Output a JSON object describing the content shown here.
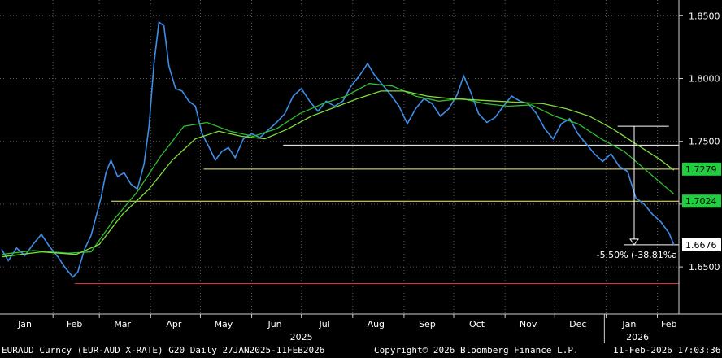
{
  "chart_data": {
    "type": "line",
    "series": [
      {
        "name": "",
        "color": "#3d8ee8",
        "values": [
          [
            "2025-01-01",
            1.664
          ],
          [
            "2025-01-05",
            1.655
          ],
          [
            "2025-01-10",
            1.665
          ],
          [
            "2025-01-15",
            1.659
          ],
          [
            "2025-01-20",
            1.668
          ],
          [
            "2025-01-25",
            1.676
          ],
          [
            "2025-01-30",
            1.666
          ],
          [
            "2025-02-04",
            1.658
          ],
          [
            "2025-02-08",
            1.65
          ],
          [
            "2025-02-13",
            1.642
          ],
          [
            "2025-02-16",
            1.646
          ],
          [
            "2025-02-20",
            1.664
          ],
          [
            "2025-02-24",
            1.675
          ],
          [
            "2025-02-27",
            1.69
          ],
          [
            "2025-03-02",
            1.705
          ],
          [
            "2025-03-05",
            1.725
          ],
          [
            "2025-03-08",
            1.735
          ],
          [
            "2025-03-12",
            1.722
          ],
          [
            "2025-03-16",
            1.725
          ],
          [
            "2025-03-20",
            1.716
          ],
          [
            "2025-03-24",
            1.712
          ],
          [
            "2025-03-28",
            1.732
          ],
          [
            "2025-03-31",
            1.762
          ],
          [
            "2025-04-03",
            1.812
          ],
          [
            "2025-04-06",
            1.845
          ],
          [
            "2025-04-09",
            1.842
          ],
          [
            "2025-04-12",
            1.81
          ],
          [
            "2025-04-16",
            1.792
          ],
          [
            "2025-04-20",
            1.79
          ],
          [
            "2025-04-24",
            1.782
          ],
          [
            "2025-04-28",
            1.778
          ],
          [
            "2025-05-02",
            1.756
          ],
          [
            "2025-05-06",
            1.746
          ],
          [
            "2025-05-10",
            1.735
          ],
          [
            "2025-05-14",
            1.742
          ],
          [
            "2025-05-18",
            1.745
          ],
          [
            "2025-05-22",
            1.737
          ],
          [
            "2025-05-27",
            1.752
          ],
          [
            "2025-06-01",
            1.756
          ],
          [
            "2025-06-06",
            1.753
          ],
          [
            "2025-06-11",
            1.759
          ],
          [
            "2025-06-16",
            1.765
          ],
          [
            "2025-06-21",
            1.772
          ],
          [
            "2025-06-26",
            1.786
          ],
          [
            "2025-07-01",
            1.792
          ],
          [
            "2025-07-06",
            1.782
          ],
          [
            "2025-07-11",
            1.774
          ],
          [
            "2025-07-16",
            1.782
          ],
          [
            "2025-07-21",
            1.778
          ],
          [
            "2025-07-26",
            1.782
          ],
          [
            "2025-07-31",
            1.794
          ],
          [
            "2025-08-05",
            1.802
          ],
          [
            "2025-08-10",
            1.812
          ],
          [
            "2025-08-14",
            1.803
          ],
          [
            "2025-08-19",
            1.795
          ],
          [
            "2025-08-24",
            1.787
          ],
          [
            "2025-08-29",
            1.778
          ],
          [
            "2025-09-03",
            1.764
          ],
          [
            "2025-09-08",
            1.776
          ],
          [
            "2025-09-13",
            1.784
          ],
          [
            "2025-09-18",
            1.78
          ],
          [
            "2025-09-23",
            1.77
          ],
          [
            "2025-09-28",
            1.776
          ],
          [
            "2025-10-03",
            1.787
          ],
          [
            "2025-10-07",
            1.802
          ],
          [
            "2025-10-11",
            1.79
          ],
          [
            "2025-10-16",
            1.772
          ],
          [
            "2025-10-21",
            1.765
          ],
          [
            "2025-10-26",
            1.769
          ],
          [
            "2025-10-31",
            1.778
          ],
          [
            "2025-11-05",
            1.786
          ],
          [
            "2025-11-10",
            1.782
          ],
          [
            "2025-11-15",
            1.78
          ],
          [
            "2025-11-20",
            1.772
          ],
          [
            "2025-11-25",
            1.76
          ],
          [
            "2025-11-30",
            1.752
          ],
          [
            "2025-12-05",
            1.764
          ],
          [
            "2025-12-10",
            1.768
          ],
          [
            "2025-12-15",
            1.756
          ],
          [
            "2025-12-20",
            1.748
          ],
          [
            "2025-12-25",
            1.74
          ],
          [
            "2025-12-30",
            1.734
          ],
          [
            "2026-01-04",
            1.74
          ],
          [
            "2026-01-09",
            1.73
          ],
          [
            "2026-01-14",
            1.726
          ],
          [
            "2026-01-19",
            1.705
          ],
          [
            "2026-01-24",
            1.7
          ],
          [
            "2026-01-29",
            1.692
          ],
          [
            "2026-02-03",
            1.686
          ],
          [
            "2026-02-08",
            1.677
          ],
          [
            "2026-02-11",
            1.6676
          ]
        ]
      },
      {
        "name": "",
        "color": "#2fbf2f",
        "values": [
          [
            "2025-01-01",
            1.66
          ],
          [
            "2025-01-20",
            1.663
          ],
          [
            "2025-02-10",
            1.661
          ],
          [
            "2025-02-24",
            1.662
          ],
          [
            "2025-03-10",
            1.688
          ],
          [
            "2025-03-24",
            1.71
          ],
          [
            "2025-04-07",
            1.738
          ],
          [
            "2025-04-21",
            1.762
          ],
          [
            "2025-05-05",
            1.765
          ],
          [
            "2025-05-19",
            1.758
          ],
          [
            "2025-06-02",
            1.754
          ],
          [
            "2025-06-16",
            1.76
          ],
          [
            "2025-06-30",
            1.772
          ],
          [
            "2025-07-14",
            1.78
          ],
          [
            "2025-07-28",
            1.786
          ],
          [
            "2025-08-11",
            1.796
          ],
          [
            "2025-08-25",
            1.794
          ],
          [
            "2025-09-08",
            1.786
          ],
          [
            "2025-09-22",
            1.782
          ],
          [
            "2025-10-06",
            1.784
          ],
          [
            "2025-10-20",
            1.78
          ],
          [
            "2025-11-03",
            1.778
          ],
          [
            "2025-11-17",
            1.779
          ],
          [
            "2025-12-01",
            1.77
          ],
          [
            "2025-12-15",
            1.764
          ],
          [
            "2025-12-29",
            1.752
          ],
          [
            "2026-01-12",
            1.742
          ],
          [
            "2026-01-26",
            1.726
          ],
          [
            "2026-02-11",
            1.708
          ]
        ]
      },
      {
        "name": "",
        "color": "#7fdc3a",
        "values": [
          [
            "2025-01-01",
            1.658
          ],
          [
            "2025-01-25",
            1.662
          ],
          [
            "2025-02-15",
            1.66
          ],
          [
            "2025-03-01",
            1.668
          ],
          [
            "2025-03-15",
            1.692
          ],
          [
            "2025-03-31",
            1.712
          ],
          [
            "2025-04-14",
            1.735
          ],
          [
            "2025-04-28",
            1.752
          ],
          [
            "2025-05-12",
            1.758
          ],
          [
            "2025-05-26",
            1.754
          ],
          [
            "2025-06-09",
            1.752
          ],
          [
            "2025-06-23",
            1.76
          ],
          [
            "2025-07-07",
            1.77
          ],
          [
            "2025-07-21",
            1.777
          ],
          [
            "2025-08-04",
            1.784
          ],
          [
            "2025-08-18",
            1.79
          ],
          [
            "2025-09-01",
            1.79
          ],
          [
            "2025-09-15",
            1.786
          ],
          [
            "2025-09-29",
            1.784
          ],
          [
            "2025-10-13",
            1.783
          ],
          [
            "2025-10-27",
            1.782
          ],
          [
            "2025-11-10",
            1.781
          ],
          [
            "2025-11-24",
            1.78
          ],
          [
            "2025-12-08",
            1.776
          ],
          [
            "2025-12-22",
            1.77
          ],
          [
            "2026-01-05",
            1.76
          ],
          [
            "2026-01-19",
            1.748
          ],
          [
            "2026-02-02",
            1.736
          ],
          [
            "2026-02-11",
            1.727
          ]
        ]
      }
    ],
    "hlines": [
      {
        "y": 1.6676,
        "from": "2026-01-12",
        "to": "2026-02-14",
        "color": "#ffffff"
      },
      {
        "y": 1.7024,
        "from": "2025-03-08",
        "to": "2026-02-14",
        "color": "#f5f27a"
      },
      {
        "y": 1.7279,
        "from": "2025-05-03",
        "to": "2026-02-14",
        "color": "#f5f27a"
      },
      {
        "y": 1.747,
        "from": "2025-06-20",
        "to": "2026-02-14",
        "color": "#ffffff"
      },
      {
        "y": 1.762,
        "from": "2026-01-08",
        "to": "2026-02-08",
        "color": "#ffffff"
      },
      {
        "y": 1.6368,
        "from": "2025-02-14",
        "to": "2026-02-14",
        "color": "#e0313c"
      }
    ],
    "yticks": [
      {
        "value": 1.65,
        "label": "1.6500"
      },
      {
        "value": 1.7,
        "label": ""
      },
      {
        "value": 1.75,
        "label": "1.7500"
      },
      {
        "value": 1.8,
        "label": "1.8000"
      },
      {
        "value": 1.85,
        "label": "1.8500"
      }
    ],
    "price_labels": [
      {
        "value": 1.7279,
        "label": "1.7279",
        "bg": "#1fcf3f",
        "fg": "#000000"
      },
      {
        "value": 1.7024,
        "label": "1.7024",
        "bg": "#1fcf3f",
        "fg": "#000000"
      },
      {
        "value": 1.6676,
        "label": "1.6676",
        "bg": "#ffffff",
        "fg": "#000000"
      }
    ],
    "measure": {
      "x": "2026-01-18",
      "from": 1.762,
      "to": 1.6676,
      "label": "-5.50% (-38.81%a"
    },
    "xlabels": [
      "Jan",
      "Feb",
      "Mar",
      "Apr",
      "May",
      "Jun",
      "Jul",
      "Aug",
      "Sep",
      "Oct",
      "Nov",
      "Dec",
      "Jan",
      "Feb"
    ],
    "xlabel_dates": [
      "2025-01-15",
      "2025-02-14",
      "2025-03-15",
      "2025-04-15",
      "2025-05-15",
      "2025-06-15",
      "2025-07-15",
      "2025-08-15",
      "2025-09-15",
      "2025-10-15",
      "2025-11-15",
      "2025-12-15",
      "2026-01-15",
      "2026-02-08"
    ],
    "year_labels": [
      {
        "date": "2025-07-01",
        "label": "2025"
      },
      {
        "date": "2026-01-20",
        "label": "2026"
      }
    ],
    "year_divider": "2025-12-31",
    "month_starts": [
      "2025-02-01",
      "2025-03-01",
      "2025-04-01",
      "2025-05-01",
      "2025-06-01",
      "2025-07-01",
      "2025-08-01",
      "2025-09-01",
      "2025-10-01",
      "2025-11-01",
      "2025-12-01",
      "2026-01-01",
      "2026-02-01"
    ],
    "xlim": [
      "2024-12-31",
      "2026-02-14"
    ],
    "ylim": [
      1.6125,
      1.8625
    ],
    "grid": true,
    "title": "",
    "xlabel": "",
    "ylabel": ""
  },
  "footer": {
    "left": "EURAUD Curncy (EUR-AUD X-RATE) G20 Daily 27JAN2025-11FEB2026",
    "center": "Copyright© 2026 Bloomberg Finance L.P.",
    "right": "11-Feb-2026 17:03:36"
  }
}
